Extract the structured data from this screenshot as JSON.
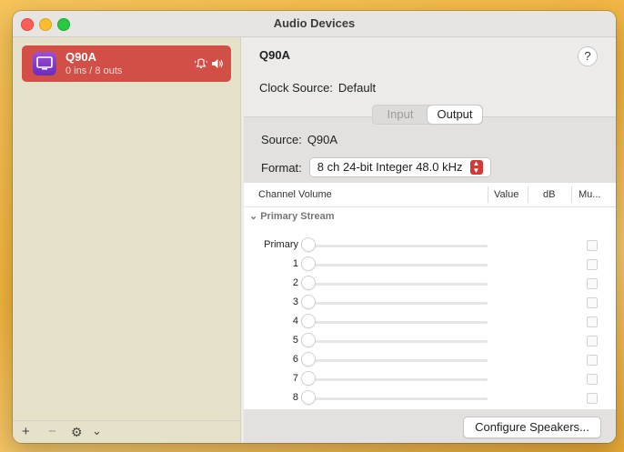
{
  "window": {
    "title": "Audio Devices"
  },
  "sidebar": {
    "devices": [
      {
        "name": "Q90A",
        "io": "0 ins / 8 outs"
      }
    ],
    "footer": {
      "add": "+",
      "remove": "−",
      "gear": "⚙",
      "menu": "⌄"
    }
  },
  "device": {
    "name": "Q90A",
    "help": "?",
    "clock_label": "Clock Source:",
    "clock_value": "Default",
    "tabs": [
      "Input",
      "Output"
    ],
    "active_tab": "Output",
    "source_label": "Source:",
    "source_value": "Q90A",
    "format_label": "Format:",
    "format_value": "8 ch 24-bit Integer 48.0 kHz"
  },
  "table": {
    "headers": {
      "channel": "Channel Volume",
      "value": "Value",
      "db": "dB",
      "mute": "Mu..."
    },
    "group": "Primary Stream",
    "rows": [
      "Primary",
      "1",
      "2",
      "3",
      "4",
      "5",
      "6",
      "7",
      "8"
    ]
  },
  "buttons": {
    "configure": "Configure Speakers..."
  },
  "colors": {
    "selection": "#d24f48",
    "sidebar": "#e6e2c9",
    "accent": "#d33a33"
  }
}
